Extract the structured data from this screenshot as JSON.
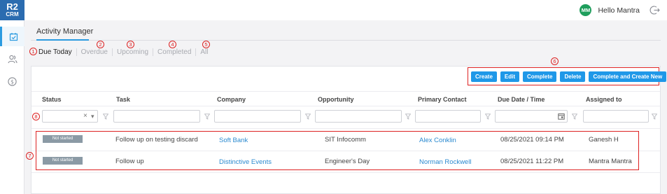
{
  "app": {
    "logo_line1": "R2",
    "logo_line2": "CRM"
  },
  "rail": [
    {
      "icon": "calendar-check-icon",
      "active": true
    },
    {
      "icon": "contacts-icon",
      "active": false
    },
    {
      "icon": "dollar-icon",
      "active": false
    }
  ],
  "header": {
    "avatar_initials": "MM",
    "greeting": "Hello Mantra",
    "logout_icon": "logout-icon"
  },
  "page": {
    "title": "Activity Manager"
  },
  "tabs": [
    {
      "label": "Due Today",
      "marker": "1",
      "active": true
    },
    {
      "label": "Overdue",
      "marker": "2",
      "active": false
    },
    {
      "label": "Upcoming",
      "marker": "3",
      "active": false
    },
    {
      "label": "Completed",
      "marker": "4",
      "active": false
    },
    {
      "label": "All",
      "marker": "5",
      "active": false
    }
  ],
  "toolbar": {
    "marker": "6",
    "buttons": [
      "Create",
      "Edit",
      "Complete",
      "Delete",
      "Complete and Create New"
    ]
  },
  "columns": [
    "Status",
    "Task",
    "Company",
    "Opportunity",
    "Primary Contact",
    "Due Date / Time",
    "Assigned to"
  ],
  "filters": {
    "marker": "8",
    "status_clear": "×",
    "status_caret": "▾"
  },
  "rows_marker": "7",
  "rows": [
    {
      "status": "Not started",
      "task": "Follow up on testing discard",
      "company": "Soft Bank",
      "opportunity": "SIT Infocomm",
      "contact": "Alex Conklin",
      "due": "08/25/2021 09:14 PM",
      "assigned": "Ganesh H"
    },
    {
      "status": "Not started",
      "task": "Follow up",
      "company": "Distinctive Events",
      "opportunity": "Engineer's Day",
      "contact": "Norman Rockwell",
      "due": "08/25/2021 11:22 PM",
      "assigned": "Mantra Mantra"
    }
  ],
  "colors": {
    "accent": "#2b9be0",
    "button": "#1f98e8",
    "annotation": "#dd2222",
    "status_badge": "#8b9aa5",
    "link": "#2b8ad0"
  }
}
